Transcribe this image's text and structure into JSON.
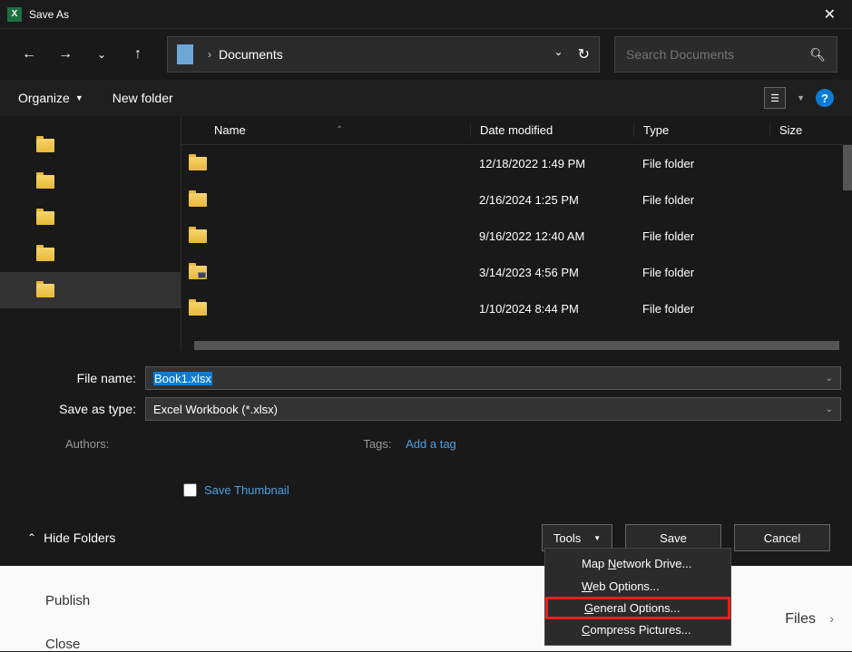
{
  "titlebar": {
    "title": "Save As"
  },
  "breadcrumb": {
    "location": "Documents"
  },
  "search": {
    "placeholder": "Search Documents"
  },
  "toolbar": {
    "organize": "Organize",
    "newfolder": "New folder"
  },
  "columns": {
    "name": "Name",
    "date": "Date modified",
    "type": "Type",
    "size": "Size"
  },
  "files": [
    {
      "date": "12/18/2022 1:49 PM",
      "type": "File folder"
    },
    {
      "date": "2/16/2024 1:25 PM",
      "type": "File folder"
    },
    {
      "date": "9/16/2022 12:40 AM",
      "type": "File folder"
    },
    {
      "date": "3/14/2023 4:56 PM",
      "type": "File folder",
      "special": true
    },
    {
      "date": "1/10/2024 8:44 PM",
      "type": "File folder"
    }
  ],
  "form": {
    "filename_label": "File name:",
    "filename_value": "Book1.xlsx",
    "savetype_label": "Save as type:",
    "savetype_value": "Excel Workbook (*.xlsx)",
    "authors_label": "Authors:",
    "tags_label": "Tags:",
    "tags_link": "Add a tag",
    "thumbnail_label": "Save Thumbnail"
  },
  "actions": {
    "hide_folders": "Hide Folders",
    "tools": "Tools",
    "save": "Save",
    "cancel": "Cancel"
  },
  "tools_menu": {
    "map_drive": "Map Network Drive...",
    "web_options": "Web Options...",
    "general_options": "General Options...",
    "compress": "Compress Pictures..."
  },
  "background": {
    "publish": "Publish",
    "close": "Close",
    "files": "Files"
  }
}
